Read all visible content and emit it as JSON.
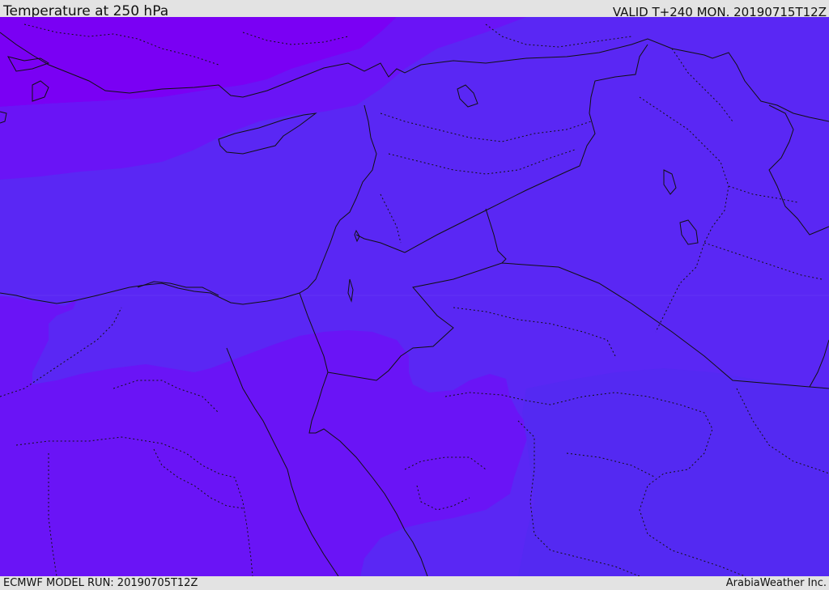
{
  "header": {
    "title": "Temperature at 250 hPa",
    "valid_time": "VALID T+240 MON. 20190715T12Z"
  },
  "footer": {
    "model_run": "ECMWF MODEL RUN: 20190705T12Z",
    "credit": "ArabiaWeather Inc."
  },
  "colors": {
    "band_coldest": "#7a00f4",
    "band_cold": "#6a14f6",
    "band_mid": "#5a27f4",
    "band_warm": "#5429f2",
    "border_line": "#111111",
    "frame_background": "#e3e3e3"
  }
}
